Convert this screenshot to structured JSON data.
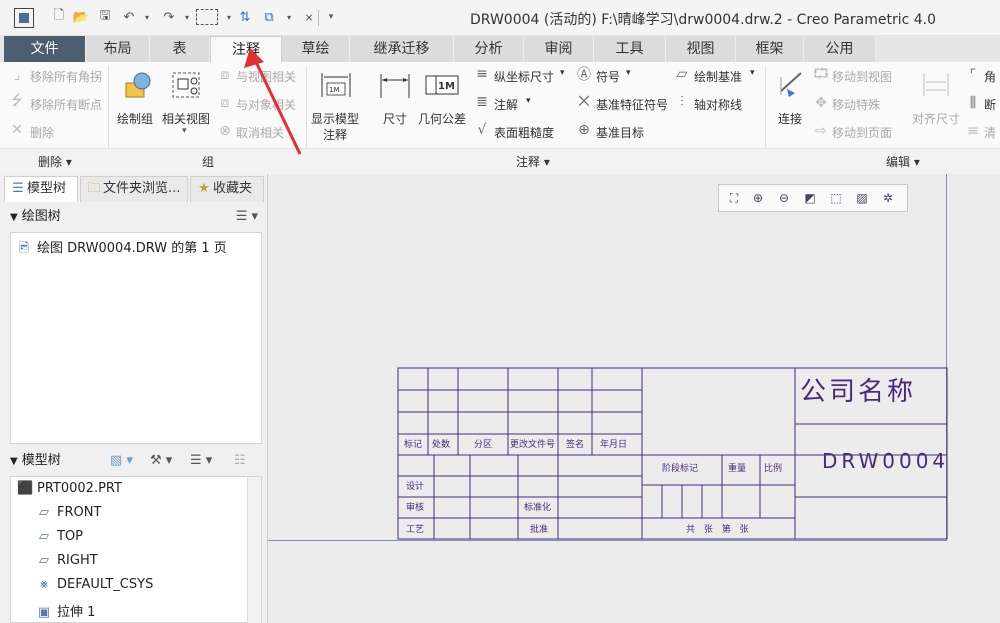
{
  "window": {
    "title": "DRW0004 (活动的) F:\\晴峰学习\\drw0004.drw.2 - Creo Parametric 4.0"
  },
  "tabs": [
    {
      "label": "文件"
    },
    {
      "label": "布局"
    },
    {
      "label": "表"
    },
    {
      "label": "注释"
    },
    {
      "label": "草绘"
    },
    {
      "label": "继承迁移"
    },
    {
      "label": "分析"
    },
    {
      "label": "审阅"
    },
    {
      "label": "工具"
    },
    {
      "label": "视图"
    },
    {
      "label": "框架"
    },
    {
      "label": "公用"
    }
  ],
  "ribbon": {
    "delete_group": {
      "remove_all_corners": "移除所有角拐",
      "remove_all_breaks": "移除所有断点",
      "delete": "删除",
      "label": "删除"
    },
    "group_group": {
      "draw_group": "绘制组",
      "related_view": "相关视图",
      "relate_to_view": "与视图相关",
      "relate_to_object": "与对象相关",
      "cancel_relation": "取消相关",
      "label": "组"
    },
    "annotation_group": {
      "show_model_annotation_1": "显示模型",
      "show_model_annotation_2": "注释",
      "dimension": "尺寸",
      "geometric_tolerance": "几何公差",
      "ordinate_dimension": "纵坐标尺寸",
      "note": "注解",
      "surface_finish": "表面粗糙度",
      "symbol": "符号",
      "datum_feature_symbol": "基准特征符号",
      "datum_target": "基准目标",
      "draw_datum": "绘制基准",
      "axis_symmetry": "轴对称线",
      "label": "注释"
    },
    "edit_group": {
      "connect": "连接",
      "move_to_view": "移动到视图",
      "move_special": "移动特殊",
      "move_to_page": "移动到页面",
      "align_dimension": "对齐尺寸",
      "corner": "角",
      "break": "断",
      "clear": "清",
      "label": "编辑"
    }
  },
  "left_panel": {
    "tabs": [
      "模型树",
      "文件夹浏览...",
      "收藏夹"
    ],
    "drawing_tree_header": "绘图树",
    "drawing_tree_items": [
      "绘图 DRW0004.DRW 的第 1 页"
    ],
    "model_tree_header": "模型树",
    "model_tree_items": [
      {
        "label": "PRT0002.PRT",
        "icon": "part-icon"
      },
      {
        "label": "FRONT",
        "icon": "datum-plane-icon"
      },
      {
        "label": "TOP",
        "icon": "datum-plane-icon"
      },
      {
        "label": "RIGHT",
        "icon": "datum-plane-icon"
      },
      {
        "label": "DEFAULT_CSYS",
        "icon": "csys-icon"
      },
      {
        "label": "拉伸 1",
        "icon": "extrude-icon"
      }
    ]
  },
  "title_block": {
    "company_name": "公司名称",
    "drawing_number": "DRW0004",
    "row_labels": [
      "标记",
      "处数",
      "分区",
      "更改文件号",
      "签名",
      "年月日"
    ],
    "design": "设计",
    "review": "审核",
    "process": "工艺",
    "standardization": "标准化",
    "approve": "批准",
    "stage_mark": "阶段标记",
    "weight": "重量",
    "scale": "比例",
    "sheets_text": "共 张 第 张"
  },
  "colors": {
    "title_block_line": "#4a2a7a",
    "file_tab_bg": "#4b5d6e",
    "arrow": "#e03030"
  }
}
